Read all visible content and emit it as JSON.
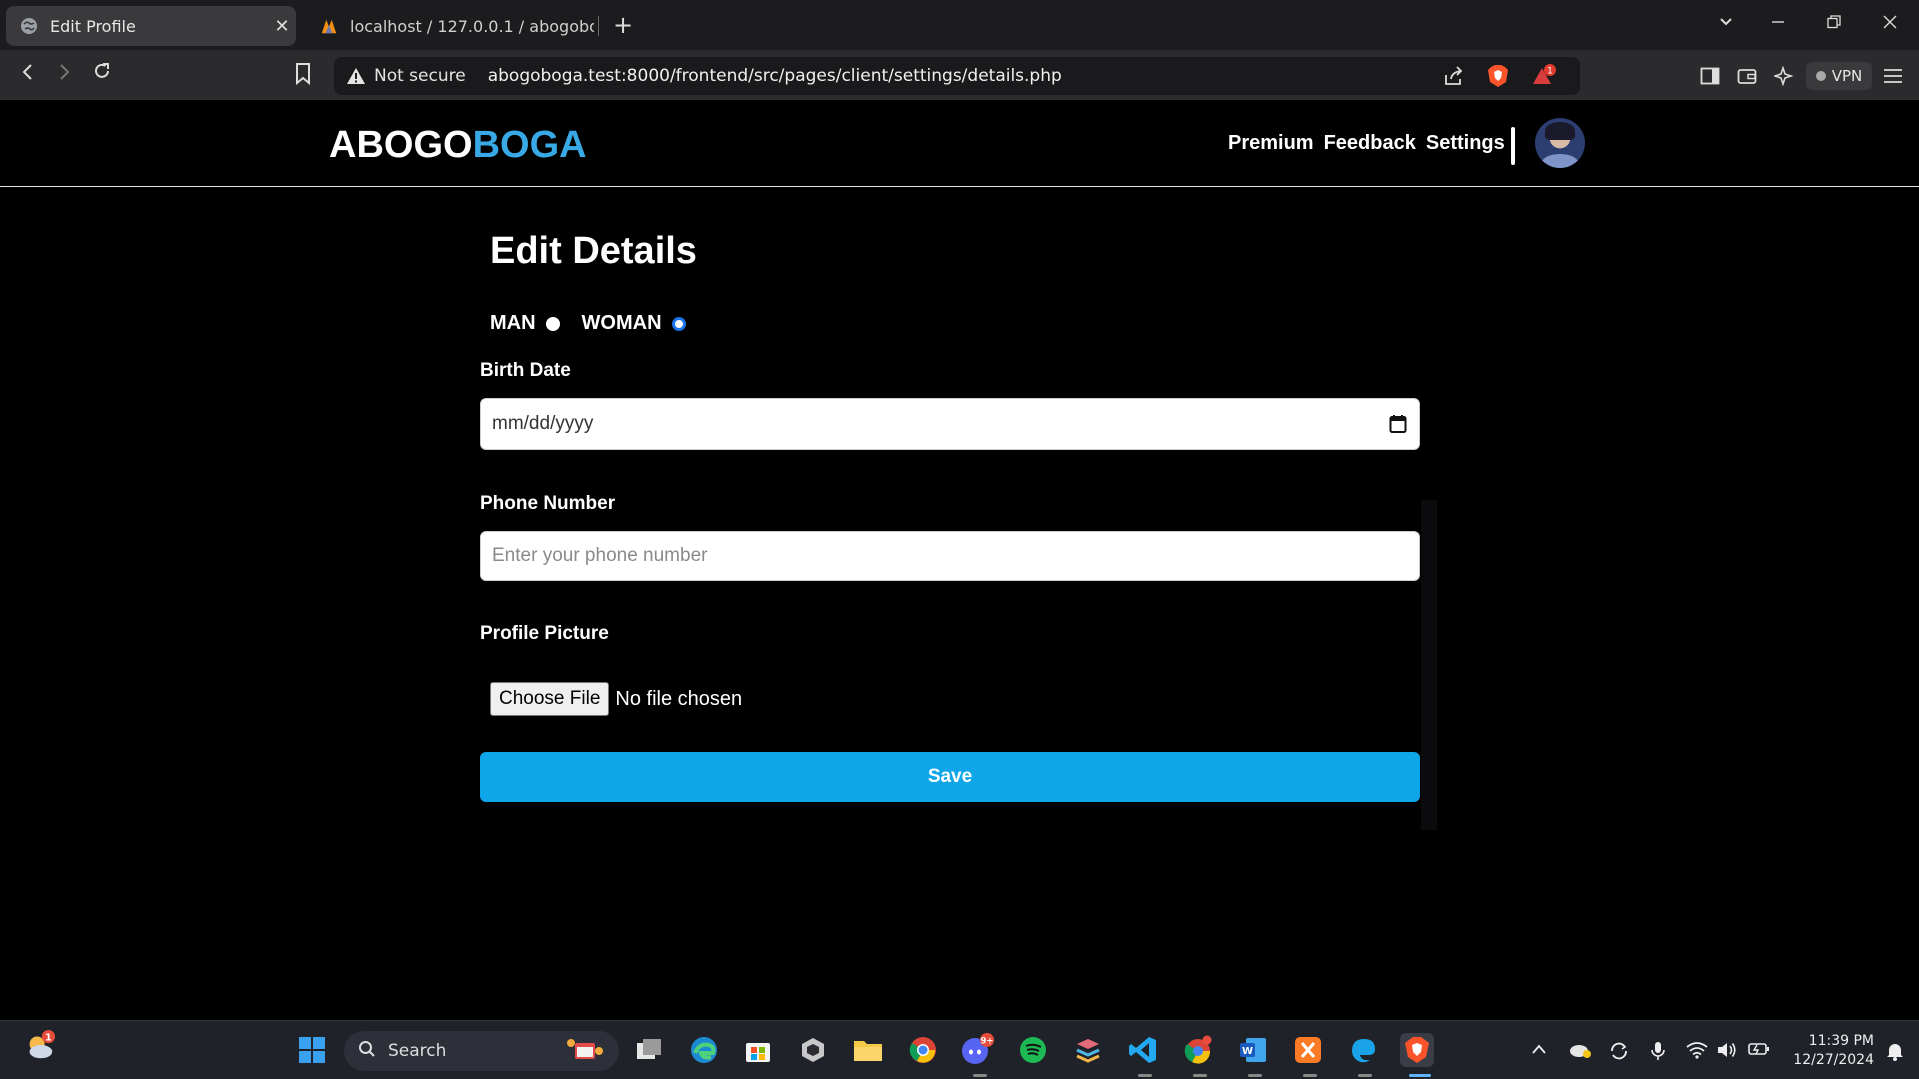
{
  "browser": {
    "tabs": [
      {
        "title": "Edit Profile",
        "close": "✕"
      },
      {
        "title": "localhost / 127.0.0.1 / abogoboga /"
      }
    ],
    "new_tab": "+",
    "address": {
      "security_label": "Not secure",
      "url": "abogoboga.test:8000/frontend/src/pages/client/settings/details.php"
    },
    "vpn_label": "VPN",
    "shield_badge": "1"
  },
  "site": {
    "logo_part1": "ABOGO",
    "logo_part2": "BOGA",
    "nav": [
      "Premium",
      "Feedback",
      "Settings"
    ],
    "accent": "#38a9e6"
  },
  "form": {
    "title": "Edit Details",
    "gender": {
      "man": "MAN",
      "woman": "WOMAN",
      "selected": "WOMAN"
    },
    "birth_date": {
      "label": "Birth Date",
      "value": "mm/dd/yyyy"
    },
    "phone": {
      "label": "Phone Number",
      "placeholder": "Enter your phone number"
    },
    "picture": {
      "label": "Profile Picture",
      "button": "Choose File",
      "status": "No file chosen"
    },
    "save": "Save",
    "save_color": "#0ea5e9"
  },
  "taskbar": {
    "search": "Search",
    "weather_badge": "1",
    "discord_badge": "9+",
    "time": "11:39 PM",
    "date": "12/27/2024"
  }
}
